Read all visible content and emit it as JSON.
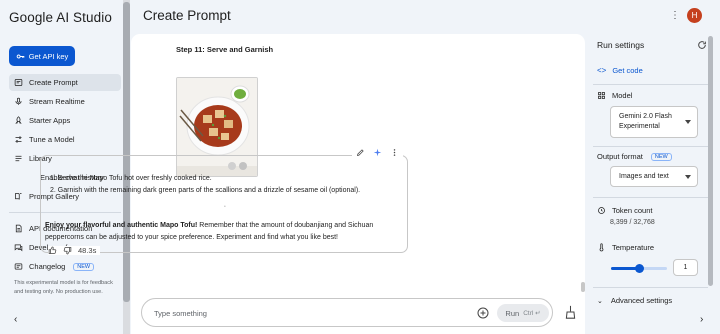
{
  "app": {
    "brand": "Google AI Studio",
    "page_title": "Create Prompt",
    "avatar_initial": "H"
  },
  "sidebar": {
    "api_key_label": "Get API key",
    "items": [
      {
        "label": "Create Prompt",
        "icon": "prompt-icon",
        "active": true
      },
      {
        "label": "Stream Realtime",
        "icon": "mic-icon"
      },
      {
        "label": "Starter Apps",
        "icon": "rocket-icon"
      },
      {
        "label": "Tune a Model",
        "icon": "tune-icon"
      },
      {
        "label": "Library",
        "icon": "library-icon"
      },
      {
        "label": "Enable chat history",
        "icon": "none"
      },
      {
        "label": "Prompt Gallery",
        "icon": "book-icon"
      }
    ],
    "bottom_items": [
      {
        "label": "API documentation",
        "icon": "doc-icon"
      },
      {
        "label": "Developer forum",
        "icon": "forum-icon"
      },
      {
        "label": "Changelog",
        "icon": "changelog-icon",
        "badge": "NEW"
      }
    ],
    "disclaimer": "This experimental model is for feedback and testing only. No production use."
  },
  "chat": {
    "step_title": "Step 11: Serve and Garnish",
    "list": [
      "1. Serve the Mapo Tofu hot over freshly cooked rice.",
      "2. Garnish with the remaining dark green parts of the scallions and a drizzle of sesame oil (optional)."
    ],
    "para_bold": "Enjoy your flavorful and authentic Mapo Tofu!",
    "para_rest": " Remember that the amount of doubanjiang and Sichuan peppercorns can be adjusted to your spice preference. Experiment and find what you like best!",
    "elapsed": "48.3s",
    "composer_placeholder": "Type something",
    "run_label": "Run",
    "run_shortcut": "Ctrl ↵"
  },
  "run_settings": {
    "title": "Run settings",
    "get_code": "Get code",
    "model_label": "Model",
    "model_value": "Gemini 2.0 Flash Experimental",
    "output_label": "Output format",
    "output_badge": "NEW",
    "output_value": "Images and text",
    "token_label": "Token count",
    "token_value": "8,399 / 32,768",
    "temperature_label": "Temperature",
    "temperature_value": "1",
    "temperature_max": 2,
    "advanced_label": "Advanced settings"
  },
  "colors": {
    "accent": "#0b57d0",
    "avatar": "#c5401e",
    "background": "#f0f4f9"
  }
}
